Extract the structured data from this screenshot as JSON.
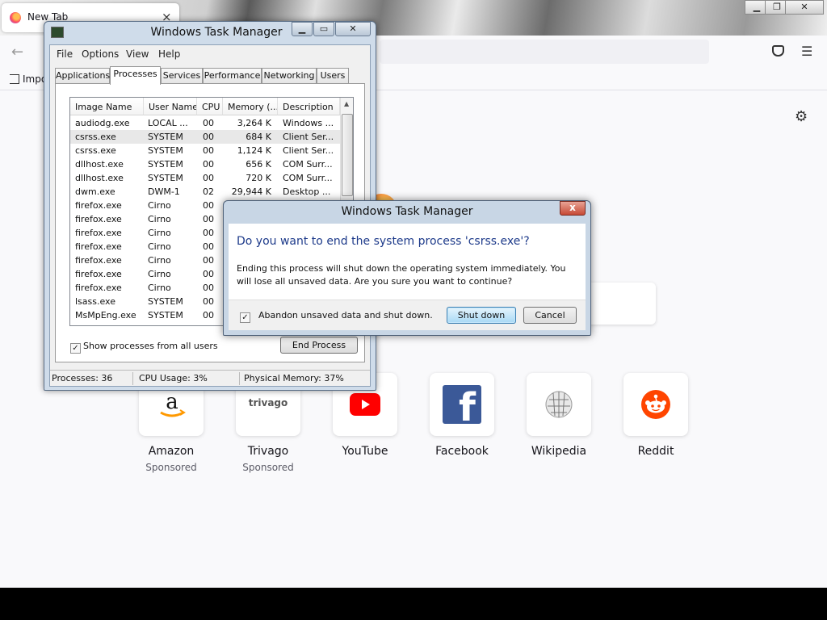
{
  "browser": {
    "tab_title": "New Tab",
    "tab_close": "×",
    "bookmark_import": "Impo",
    "top_sites": [
      {
        "label": "Amazon",
        "sub": "Sponsored",
        "icon": "amazon-icon"
      },
      {
        "label": "Trivago",
        "sub": "Sponsored",
        "icon": "trivago-icon",
        "icon_text": "trivago"
      },
      {
        "label": "YouTube",
        "sub": "",
        "icon": "youtube-icon"
      },
      {
        "label": "Facebook",
        "sub": "",
        "icon": "facebook-icon",
        "icon_text": "f"
      },
      {
        "label": "Wikipedia",
        "sub": "",
        "icon": "wikipedia-icon"
      },
      {
        "label": "Reddit",
        "sub": "",
        "icon": "reddit-icon"
      }
    ],
    "colors": {
      "youtube": "#ff0000",
      "facebook": "#3b5998",
      "reddit": "#ff4500",
      "trivago_text": "#555555"
    }
  },
  "task_manager": {
    "title": "Windows Task Manager",
    "menu": [
      "File",
      "Options",
      "View",
      "Help"
    ],
    "tabs": [
      "Applications",
      "Processes",
      "Services",
      "Performance",
      "Networking",
      "Users"
    ],
    "active_tab": "Processes",
    "columns": [
      "Image Name",
      "User Name",
      "CPU",
      "Memory (...",
      "Description"
    ],
    "processes": [
      [
        "audiodg.exe",
        "LOCAL ...",
        "00",
        "3,264 K",
        "Windows ..."
      ],
      [
        "csrss.exe",
        "SYSTEM",
        "00",
        "684 K",
        "Client Ser..."
      ],
      [
        "csrss.exe",
        "SYSTEM",
        "00",
        "1,124 K",
        "Client Ser..."
      ],
      [
        "dllhost.exe",
        "SYSTEM",
        "00",
        "656 K",
        "COM Surr..."
      ],
      [
        "dllhost.exe",
        "SYSTEM",
        "00",
        "720 K",
        "COM Surr..."
      ],
      [
        "dwm.exe",
        "DWM-1",
        "02",
        "29,944 K",
        "Desktop ..."
      ],
      [
        "firefox.exe",
        "Cirno",
        "00",
        "",
        ""
      ],
      [
        "firefox.exe",
        "Cirno",
        "00",
        "",
        ""
      ],
      [
        "firefox.exe",
        "Cirno",
        "00",
        "",
        ""
      ],
      [
        "firefox.exe",
        "Cirno",
        "00",
        "",
        ""
      ],
      [
        "firefox.exe",
        "Cirno",
        "00",
        "",
        ""
      ],
      [
        "firefox.exe",
        "Cirno",
        "00",
        "",
        ""
      ],
      [
        "firefox.exe",
        "Cirno",
        "00",
        "",
        ""
      ],
      [
        "lsass.exe",
        "SYSTEM",
        "00",
        "",
        ""
      ],
      [
        "MsMpEng.exe",
        "SYSTEM",
        "00",
        "",
        ""
      ]
    ],
    "selected_row": 1,
    "show_all_label": "Show processes from all users",
    "show_all_checked": true,
    "end_process_label": "End Process",
    "status": {
      "processes": "Processes: 36",
      "cpu": "CPU Usage: 3%",
      "memory": "Physical Memory: 37%"
    }
  },
  "dialog": {
    "title": "Windows Task Manager",
    "close": "x",
    "main_instruction": "Do you want to end the system process 'csrss.exe'?",
    "detail": "Ending this process will shut down the operating system immediately.  You will lose all unsaved data.  Are you sure you want to continue?",
    "abandon_label": "Abandon unsaved data and shut down.",
    "abandon_checked": true,
    "shutdown_label": "Shut down",
    "cancel_label": "Cancel"
  }
}
